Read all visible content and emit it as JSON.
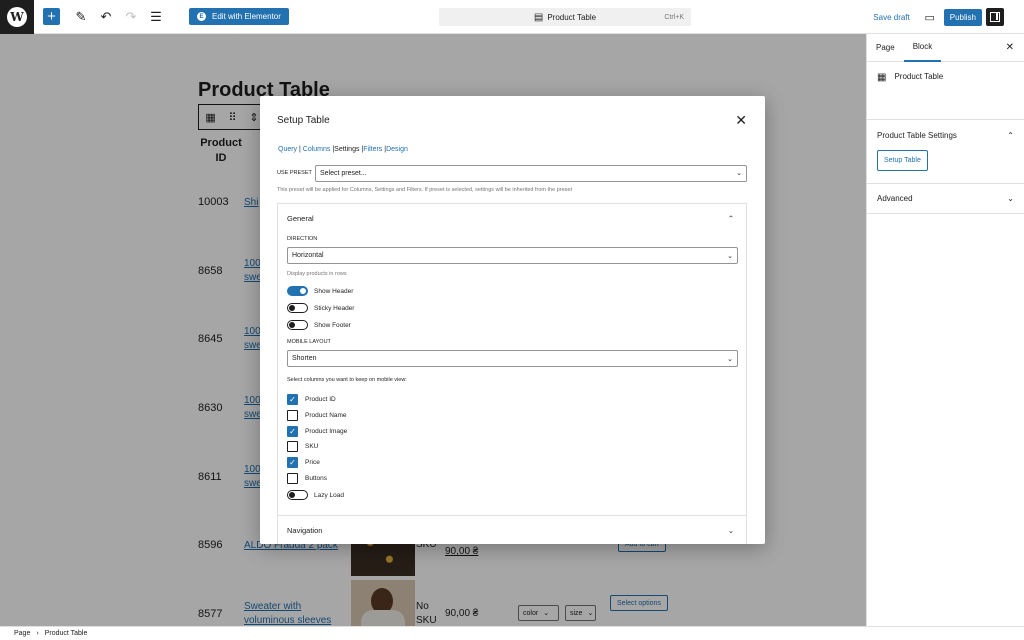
{
  "topbar": {
    "logo": "W",
    "elementor_label": "Edit with Elementor",
    "doc_title": "Product Table",
    "shortcut": "Ctrl+K",
    "save_draft": "Save draft",
    "publish": "Publish"
  },
  "canvas": {
    "title": "Product Table",
    "column_header": "Product ID",
    "rows": [
      {
        "id": "10003",
        "name": "Shi"
      },
      {
        "id": "8658",
        "name": "100 swe"
      },
      {
        "id": "8645",
        "name": "100 swe"
      },
      {
        "id": "8630",
        "name": "100 swe"
      },
      {
        "id": "8611",
        "name": "100 swe"
      },
      {
        "id": "8596",
        "name": "ALDO Fradda 2 pack",
        "sku": "SKU",
        "price": "90,00 ₴",
        "button": "Add to cart"
      },
      {
        "id": "8577",
        "name": "Sweater with voluminous sleeves",
        "sku": "No SKU",
        "price": "90,00 ₴",
        "select1": "color",
        "select2": "size",
        "button": "Select options"
      }
    ]
  },
  "sidebar": {
    "tab_page": "Page",
    "tab_block": "Block",
    "block_name": "Product Table",
    "panel_title": "Product Table Settings",
    "setup_button": "Setup Table",
    "advanced": "Advanced"
  },
  "footer": {
    "crumb1": "Page",
    "crumb2": "Product Table"
  },
  "modal": {
    "title": "Setup Table",
    "tabs": {
      "query": "Query",
      "columns": "Columns",
      "settings": "Settings",
      "filters": "Filters",
      "design": "Design"
    },
    "preset_label": "USE PRESET",
    "preset_value": "Select preset...",
    "preset_help": "This preset will be applied for Columns, Settings and Filters. If preset is selected, settings will be inherited from the preset",
    "general": {
      "title": "General",
      "direction_label": "DIRECTION",
      "direction_value": "Horizontal",
      "direction_help": "Display products in rows",
      "toggles": [
        {
          "label": "Show Header",
          "on": true
        },
        {
          "label": "Sticky Header",
          "on": false
        },
        {
          "label": "Show Footer",
          "on": false
        }
      ],
      "mobile_label": "MOBILE LAYOUT",
      "mobile_value": "Shorten",
      "mobile_help": "Select columns you want to keep on mobile view:",
      "columns": [
        {
          "label": "Product ID",
          "checked": true
        },
        {
          "label": "Product Name",
          "checked": false
        },
        {
          "label": "Product Image",
          "checked": true
        },
        {
          "label": "SKU",
          "checked": false
        },
        {
          "label": "Price",
          "checked": true
        },
        {
          "label": "Buttons",
          "checked": false
        }
      ],
      "lazy_load": "Lazy Load"
    },
    "navigation": "Navigation"
  },
  "colors": {
    "accent": "#2271b1",
    "overlay": "rgba(0,0,0,0.35)"
  }
}
